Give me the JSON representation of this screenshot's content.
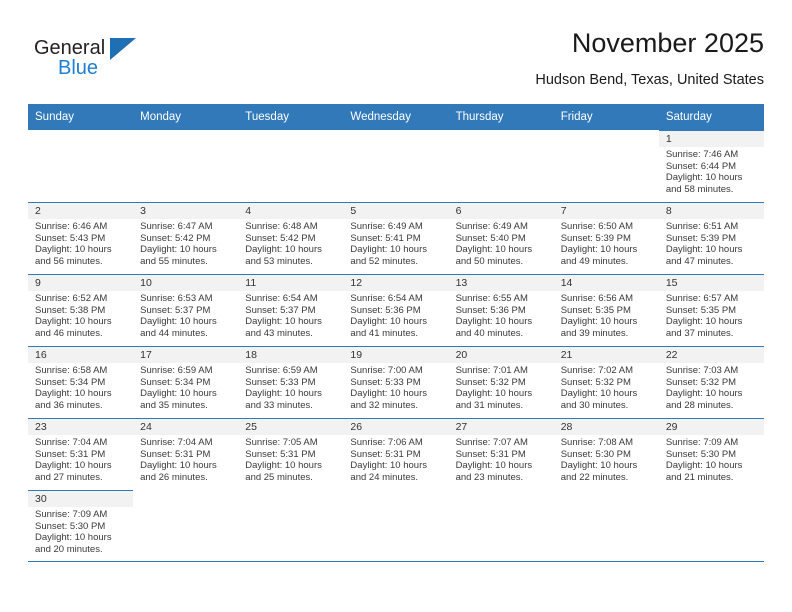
{
  "brand": {
    "word_one": "General",
    "word_two": "Blue",
    "logo_icon": "triangle-logo-icon"
  },
  "header": {
    "title": "November 2025",
    "subtitle": "Hudson Bend, Texas, United States"
  },
  "colors": {
    "header_blue": "#3179b9",
    "brand_blue": "#1f7fd4",
    "daynum_bg": "#f2f2f2",
    "text": "#3a3a3a"
  },
  "weekdays": [
    "Sunday",
    "Monday",
    "Tuesday",
    "Wednesday",
    "Thursday",
    "Friday",
    "Saturday"
  ],
  "weeks": [
    [
      {
        "day": "",
        "sunrise": "",
        "sunset": "",
        "daylight_line1": "",
        "daylight_line2": ""
      },
      {
        "day": "",
        "sunrise": "",
        "sunset": "",
        "daylight_line1": "",
        "daylight_line2": ""
      },
      {
        "day": "",
        "sunrise": "",
        "sunset": "",
        "daylight_line1": "",
        "daylight_line2": ""
      },
      {
        "day": "",
        "sunrise": "",
        "sunset": "",
        "daylight_line1": "",
        "daylight_line2": ""
      },
      {
        "day": "",
        "sunrise": "",
        "sunset": "",
        "daylight_line1": "",
        "daylight_line2": ""
      },
      {
        "day": "",
        "sunrise": "",
        "sunset": "",
        "daylight_line1": "",
        "daylight_line2": ""
      },
      {
        "day": "1",
        "sunrise": "Sunrise: 7:46 AM",
        "sunset": "Sunset: 6:44 PM",
        "daylight_line1": "Daylight: 10 hours",
        "daylight_line2": "and 58 minutes."
      }
    ],
    [
      {
        "day": "2",
        "sunrise": "Sunrise: 6:46 AM",
        "sunset": "Sunset: 5:43 PM",
        "daylight_line1": "Daylight: 10 hours",
        "daylight_line2": "and 56 minutes."
      },
      {
        "day": "3",
        "sunrise": "Sunrise: 6:47 AM",
        "sunset": "Sunset: 5:42 PM",
        "daylight_line1": "Daylight: 10 hours",
        "daylight_line2": "and 55 minutes."
      },
      {
        "day": "4",
        "sunrise": "Sunrise: 6:48 AM",
        "sunset": "Sunset: 5:42 PM",
        "daylight_line1": "Daylight: 10 hours",
        "daylight_line2": "and 53 minutes."
      },
      {
        "day": "5",
        "sunrise": "Sunrise: 6:49 AM",
        "sunset": "Sunset: 5:41 PM",
        "daylight_line1": "Daylight: 10 hours",
        "daylight_line2": "and 52 minutes."
      },
      {
        "day": "6",
        "sunrise": "Sunrise: 6:49 AM",
        "sunset": "Sunset: 5:40 PM",
        "daylight_line1": "Daylight: 10 hours",
        "daylight_line2": "and 50 minutes."
      },
      {
        "day": "7",
        "sunrise": "Sunrise: 6:50 AM",
        "sunset": "Sunset: 5:39 PM",
        "daylight_line1": "Daylight: 10 hours",
        "daylight_line2": "and 49 minutes."
      },
      {
        "day": "8",
        "sunrise": "Sunrise: 6:51 AM",
        "sunset": "Sunset: 5:39 PM",
        "daylight_line1": "Daylight: 10 hours",
        "daylight_line2": "and 47 minutes."
      }
    ],
    [
      {
        "day": "9",
        "sunrise": "Sunrise: 6:52 AM",
        "sunset": "Sunset: 5:38 PM",
        "daylight_line1": "Daylight: 10 hours",
        "daylight_line2": "and 46 minutes."
      },
      {
        "day": "10",
        "sunrise": "Sunrise: 6:53 AM",
        "sunset": "Sunset: 5:37 PM",
        "daylight_line1": "Daylight: 10 hours",
        "daylight_line2": "and 44 minutes."
      },
      {
        "day": "11",
        "sunrise": "Sunrise: 6:54 AM",
        "sunset": "Sunset: 5:37 PM",
        "daylight_line1": "Daylight: 10 hours",
        "daylight_line2": "and 43 minutes."
      },
      {
        "day": "12",
        "sunrise": "Sunrise: 6:54 AM",
        "sunset": "Sunset: 5:36 PM",
        "daylight_line1": "Daylight: 10 hours",
        "daylight_line2": "and 41 minutes."
      },
      {
        "day": "13",
        "sunrise": "Sunrise: 6:55 AM",
        "sunset": "Sunset: 5:36 PM",
        "daylight_line1": "Daylight: 10 hours",
        "daylight_line2": "and 40 minutes."
      },
      {
        "day": "14",
        "sunrise": "Sunrise: 6:56 AM",
        "sunset": "Sunset: 5:35 PM",
        "daylight_line1": "Daylight: 10 hours",
        "daylight_line2": "and 39 minutes."
      },
      {
        "day": "15",
        "sunrise": "Sunrise: 6:57 AM",
        "sunset": "Sunset: 5:35 PM",
        "daylight_line1": "Daylight: 10 hours",
        "daylight_line2": "and 37 minutes."
      }
    ],
    [
      {
        "day": "16",
        "sunrise": "Sunrise: 6:58 AM",
        "sunset": "Sunset: 5:34 PM",
        "daylight_line1": "Daylight: 10 hours",
        "daylight_line2": "and 36 minutes."
      },
      {
        "day": "17",
        "sunrise": "Sunrise: 6:59 AM",
        "sunset": "Sunset: 5:34 PM",
        "daylight_line1": "Daylight: 10 hours",
        "daylight_line2": "and 35 minutes."
      },
      {
        "day": "18",
        "sunrise": "Sunrise: 6:59 AM",
        "sunset": "Sunset: 5:33 PM",
        "daylight_line1": "Daylight: 10 hours",
        "daylight_line2": "and 33 minutes."
      },
      {
        "day": "19",
        "sunrise": "Sunrise: 7:00 AM",
        "sunset": "Sunset: 5:33 PM",
        "daylight_line1": "Daylight: 10 hours",
        "daylight_line2": "and 32 minutes."
      },
      {
        "day": "20",
        "sunrise": "Sunrise: 7:01 AM",
        "sunset": "Sunset: 5:32 PM",
        "daylight_line1": "Daylight: 10 hours",
        "daylight_line2": "and 31 minutes."
      },
      {
        "day": "21",
        "sunrise": "Sunrise: 7:02 AM",
        "sunset": "Sunset: 5:32 PM",
        "daylight_line1": "Daylight: 10 hours",
        "daylight_line2": "and 30 minutes."
      },
      {
        "day": "22",
        "sunrise": "Sunrise: 7:03 AM",
        "sunset": "Sunset: 5:32 PM",
        "daylight_line1": "Daylight: 10 hours",
        "daylight_line2": "and 28 minutes."
      }
    ],
    [
      {
        "day": "23",
        "sunrise": "Sunrise: 7:04 AM",
        "sunset": "Sunset: 5:31 PM",
        "daylight_line1": "Daylight: 10 hours",
        "daylight_line2": "and 27 minutes."
      },
      {
        "day": "24",
        "sunrise": "Sunrise: 7:04 AM",
        "sunset": "Sunset: 5:31 PM",
        "daylight_line1": "Daylight: 10 hours",
        "daylight_line2": "and 26 minutes."
      },
      {
        "day": "25",
        "sunrise": "Sunrise: 7:05 AM",
        "sunset": "Sunset: 5:31 PM",
        "daylight_line1": "Daylight: 10 hours",
        "daylight_line2": "and 25 minutes."
      },
      {
        "day": "26",
        "sunrise": "Sunrise: 7:06 AM",
        "sunset": "Sunset: 5:31 PM",
        "daylight_line1": "Daylight: 10 hours",
        "daylight_line2": "and 24 minutes."
      },
      {
        "day": "27",
        "sunrise": "Sunrise: 7:07 AM",
        "sunset": "Sunset: 5:31 PM",
        "daylight_line1": "Daylight: 10 hours",
        "daylight_line2": "and 23 minutes."
      },
      {
        "day": "28",
        "sunrise": "Sunrise: 7:08 AM",
        "sunset": "Sunset: 5:30 PM",
        "daylight_line1": "Daylight: 10 hours",
        "daylight_line2": "and 22 minutes."
      },
      {
        "day": "29",
        "sunrise": "Sunrise: 7:09 AM",
        "sunset": "Sunset: 5:30 PM",
        "daylight_line1": "Daylight: 10 hours",
        "daylight_line2": "and 21 minutes."
      }
    ],
    [
      {
        "day": "30",
        "sunrise": "Sunrise: 7:09 AM",
        "sunset": "Sunset: 5:30 PM",
        "daylight_line1": "Daylight: 10 hours",
        "daylight_line2": "and 20 minutes."
      },
      {
        "day": "",
        "sunrise": "",
        "sunset": "",
        "daylight_line1": "",
        "daylight_line2": ""
      },
      {
        "day": "",
        "sunrise": "",
        "sunset": "",
        "daylight_line1": "",
        "daylight_line2": ""
      },
      {
        "day": "",
        "sunrise": "",
        "sunset": "",
        "daylight_line1": "",
        "daylight_line2": ""
      },
      {
        "day": "",
        "sunrise": "",
        "sunset": "",
        "daylight_line1": "",
        "daylight_line2": ""
      },
      {
        "day": "",
        "sunrise": "",
        "sunset": "",
        "daylight_line1": "",
        "daylight_line2": ""
      },
      {
        "day": "",
        "sunrise": "",
        "sunset": "",
        "daylight_line1": "",
        "daylight_line2": ""
      }
    ]
  ]
}
